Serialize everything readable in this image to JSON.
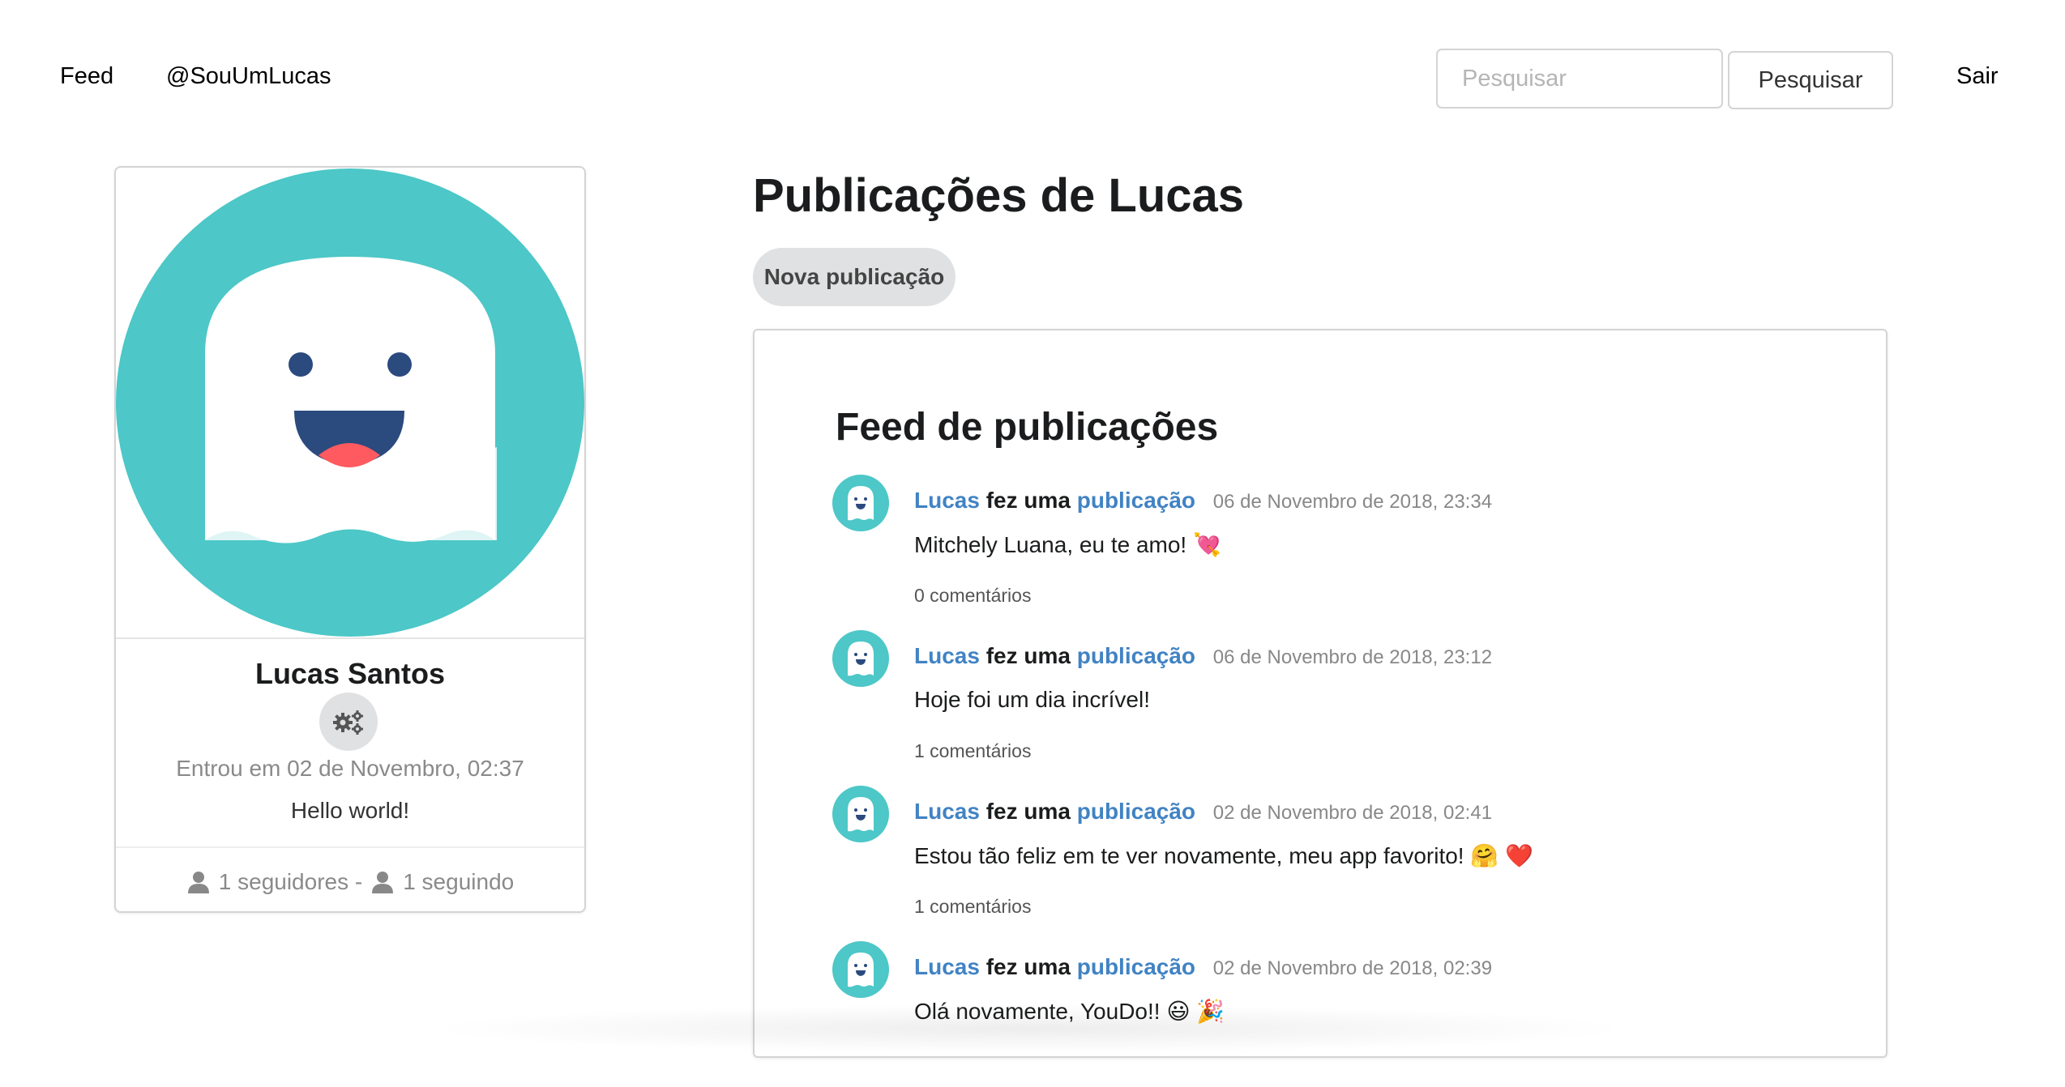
{
  "menu": {
    "feed_label": "Feed",
    "user_label": "@SouUmLucas",
    "search_placeholder": "Pesquisar",
    "search_button": "Pesquisar",
    "logout_label": "Sair"
  },
  "profile": {
    "name": "Lucas Santos",
    "joined": "Entrou em 02 de Novembro, 02:37",
    "bio": "Hello world!",
    "followers": "1 seguidores -",
    "following": "1 seguindo",
    "colors": {
      "avatar_bg": "#4dc7c7",
      "ghost_mouth": "#2b4a7e",
      "ghost_tongue": "#ff5a5f"
    }
  },
  "main": {
    "title": "Publicações de Lucas",
    "new_post_button": "Nova publicação",
    "feed_title": "Feed de publicações"
  },
  "posts": [
    {
      "user": "Lucas",
      "action": "fez uma",
      "object": "publicação",
      "date": "06 de Novembro de 2018, 23:34",
      "text": "Mitchely Luana, eu te amo! 💘",
      "comments": "0 comentários"
    },
    {
      "user": "Lucas",
      "action": "fez uma",
      "object": "publicação",
      "date": "06 de Novembro de 2018, 23:12",
      "text": "Hoje foi um dia incrível!",
      "comments": "1 comentários"
    },
    {
      "user": "Lucas",
      "action": "fez uma",
      "object": "publicação",
      "date": "02 de Novembro de 2018, 02:41",
      "text": "Estou tão feliz em te ver novamente, meu app favorito! 🤗 ❤️",
      "comments": "1 comentários"
    },
    {
      "user": "Lucas",
      "action": "fez uma",
      "object": "publicação",
      "date": "02 de Novembro de 2018, 02:39",
      "text": "Olá novamente, YouDo!! 😃 🎉",
      "comments": ""
    }
  ]
}
